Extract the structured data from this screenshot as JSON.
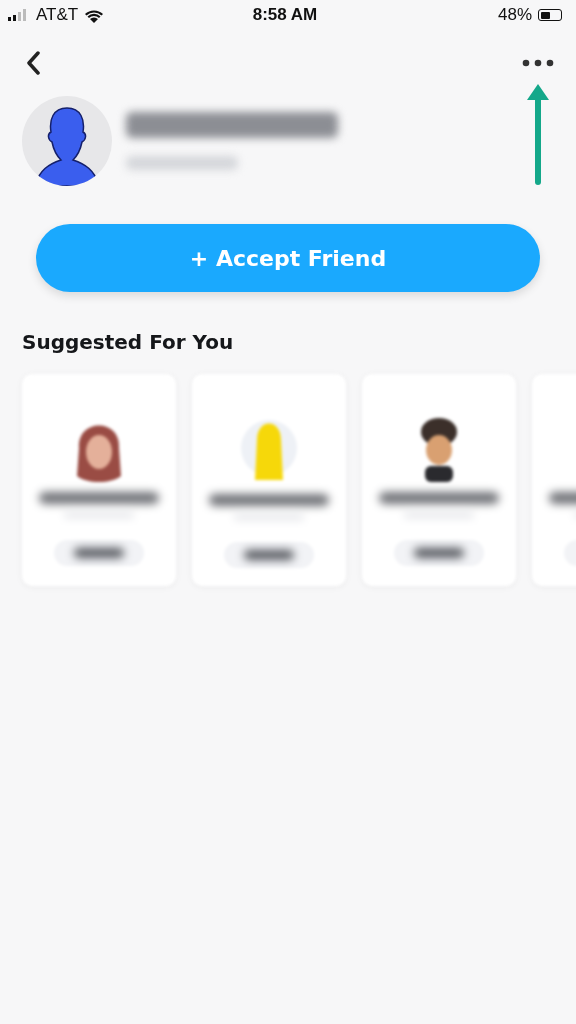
{
  "status_bar": {
    "carrier": "AT&T",
    "time": "8:58 AM",
    "battery": "48%"
  },
  "accept_button": {
    "label": "+ Accept Friend"
  },
  "section_title": "Suggested For You",
  "suggestions": [
    {
      "kind": "long-hair"
    },
    {
      "kind": "ghost"
    },
    {
      "kind": "short-hair"
    },
    {
      "kind": "partial"
    }
  ],
  "annotation": {
    "kind": "arrow-up"
  }
}
